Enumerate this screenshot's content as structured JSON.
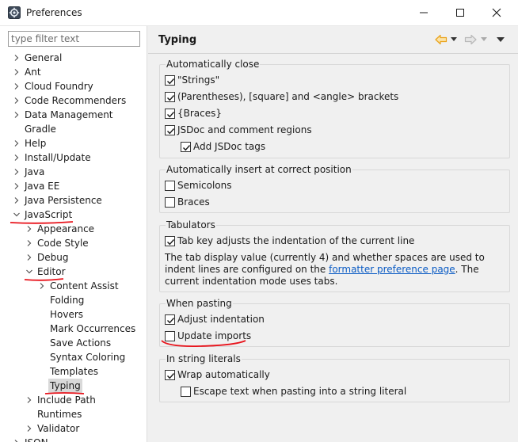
{
  "window": {
    "title": "Preferences"
  },
  "filter": {
    "placeholder": "type filter text"
  },
  "tree": {
    "general": "General",
    "ant": "Ant",
    "cloud_foundry": "Cloud Foundry",
    "code_recommenders": "Code Recommenders",
    "data_management": "Data Management",
    "gradle": "Gradle",
    "help": "Help",
    "install_update": "Install/Update",
    "java": "Java",
    "java_ee": "Java EE",
    "java_persistence": "Java Persistence",
    "javascript": "JavaScript",
    "appearance": "Appearance",
    "code_style": "Code Style",
    "debug": "Debug",
    "editor": "Editor",
    "content_assist": "Content Assist",
    "folding": "Folding",
    "hovers": "Hovers",
    "mark_occurrences": "Mark Occurrences",
    "save_actions": "Save Actions",
    "syntax_coloring": "Syntax Coloring",
    "templates": "Templates",
    "typing": "Typing",
    "include_path": "Include Path",
    "runtimes": "Runtimes",
    "validator": "Validator",
    "json": "JSON"
  },
  "page": {
    "title": "Typing"
  },
  "groups": {
    "auto_close": {
      "title": "Automatically close",
      "strings": "\"Strings\"",
      "brackets": "(Parentheses), [square] and <angle> brackets",
      "braces": "{Braces}",
      "jsdoc": "JSDoc and comment regions",
      "add_jsdoc_tags": "Add JSDoc tags"
    },
    "auto_insert": {
      "title": "Automatically insert at correct position",
      "semicolons": "Semicolons",
      "braces": "Braces"
    },
    "tabulators": {
      "title": "Tabulators",
      "tab_key": "Tab key adjusts the indentation of the current line",
      "text_before": "The tab display value (currently 4) and whether spaces are used to indent lines are configured on the ",
      "link": "formatter preference page",
      "text_after": ". The current indentation mode uses tabs."
    },
    "pasting": {
      "title": "When pasting",
      "adjust_indentation": "Adjust indentation",
      "update_imports": "Update imports"
    },
    "string_literals": {
      "title": "In string literals",
      "wrap": "Wrap automatically",
      "escape": "Escape text when pasting into a string literal"
    }
  },
  "checkbox_states": {
    "strings": true,
    "brackets": true,
    "braces": true,
    "jsdoc": true,
    "add_jsdoc_tags": true,
    "semicolons": false,
    "insert_braces": false,
    "tab_key": true,
    "adjust_indentation": true,
    "update_imports": false,
    "wrap": true,
    "escape": false
  },
  "colors": {
    "selection": "#d9d9d9",
    "link": "#0a5bc4",
    "annotation_red": "#e8141c",
    "back_arrow": "#e9a21a"
  },
  "icons": {
    "app": "preferences-gear-icon",
    "back": "back-arrow-icon",
    "forward": "forward-arrow-icon",
    "menu": "view-menu-icon"
  }
}
